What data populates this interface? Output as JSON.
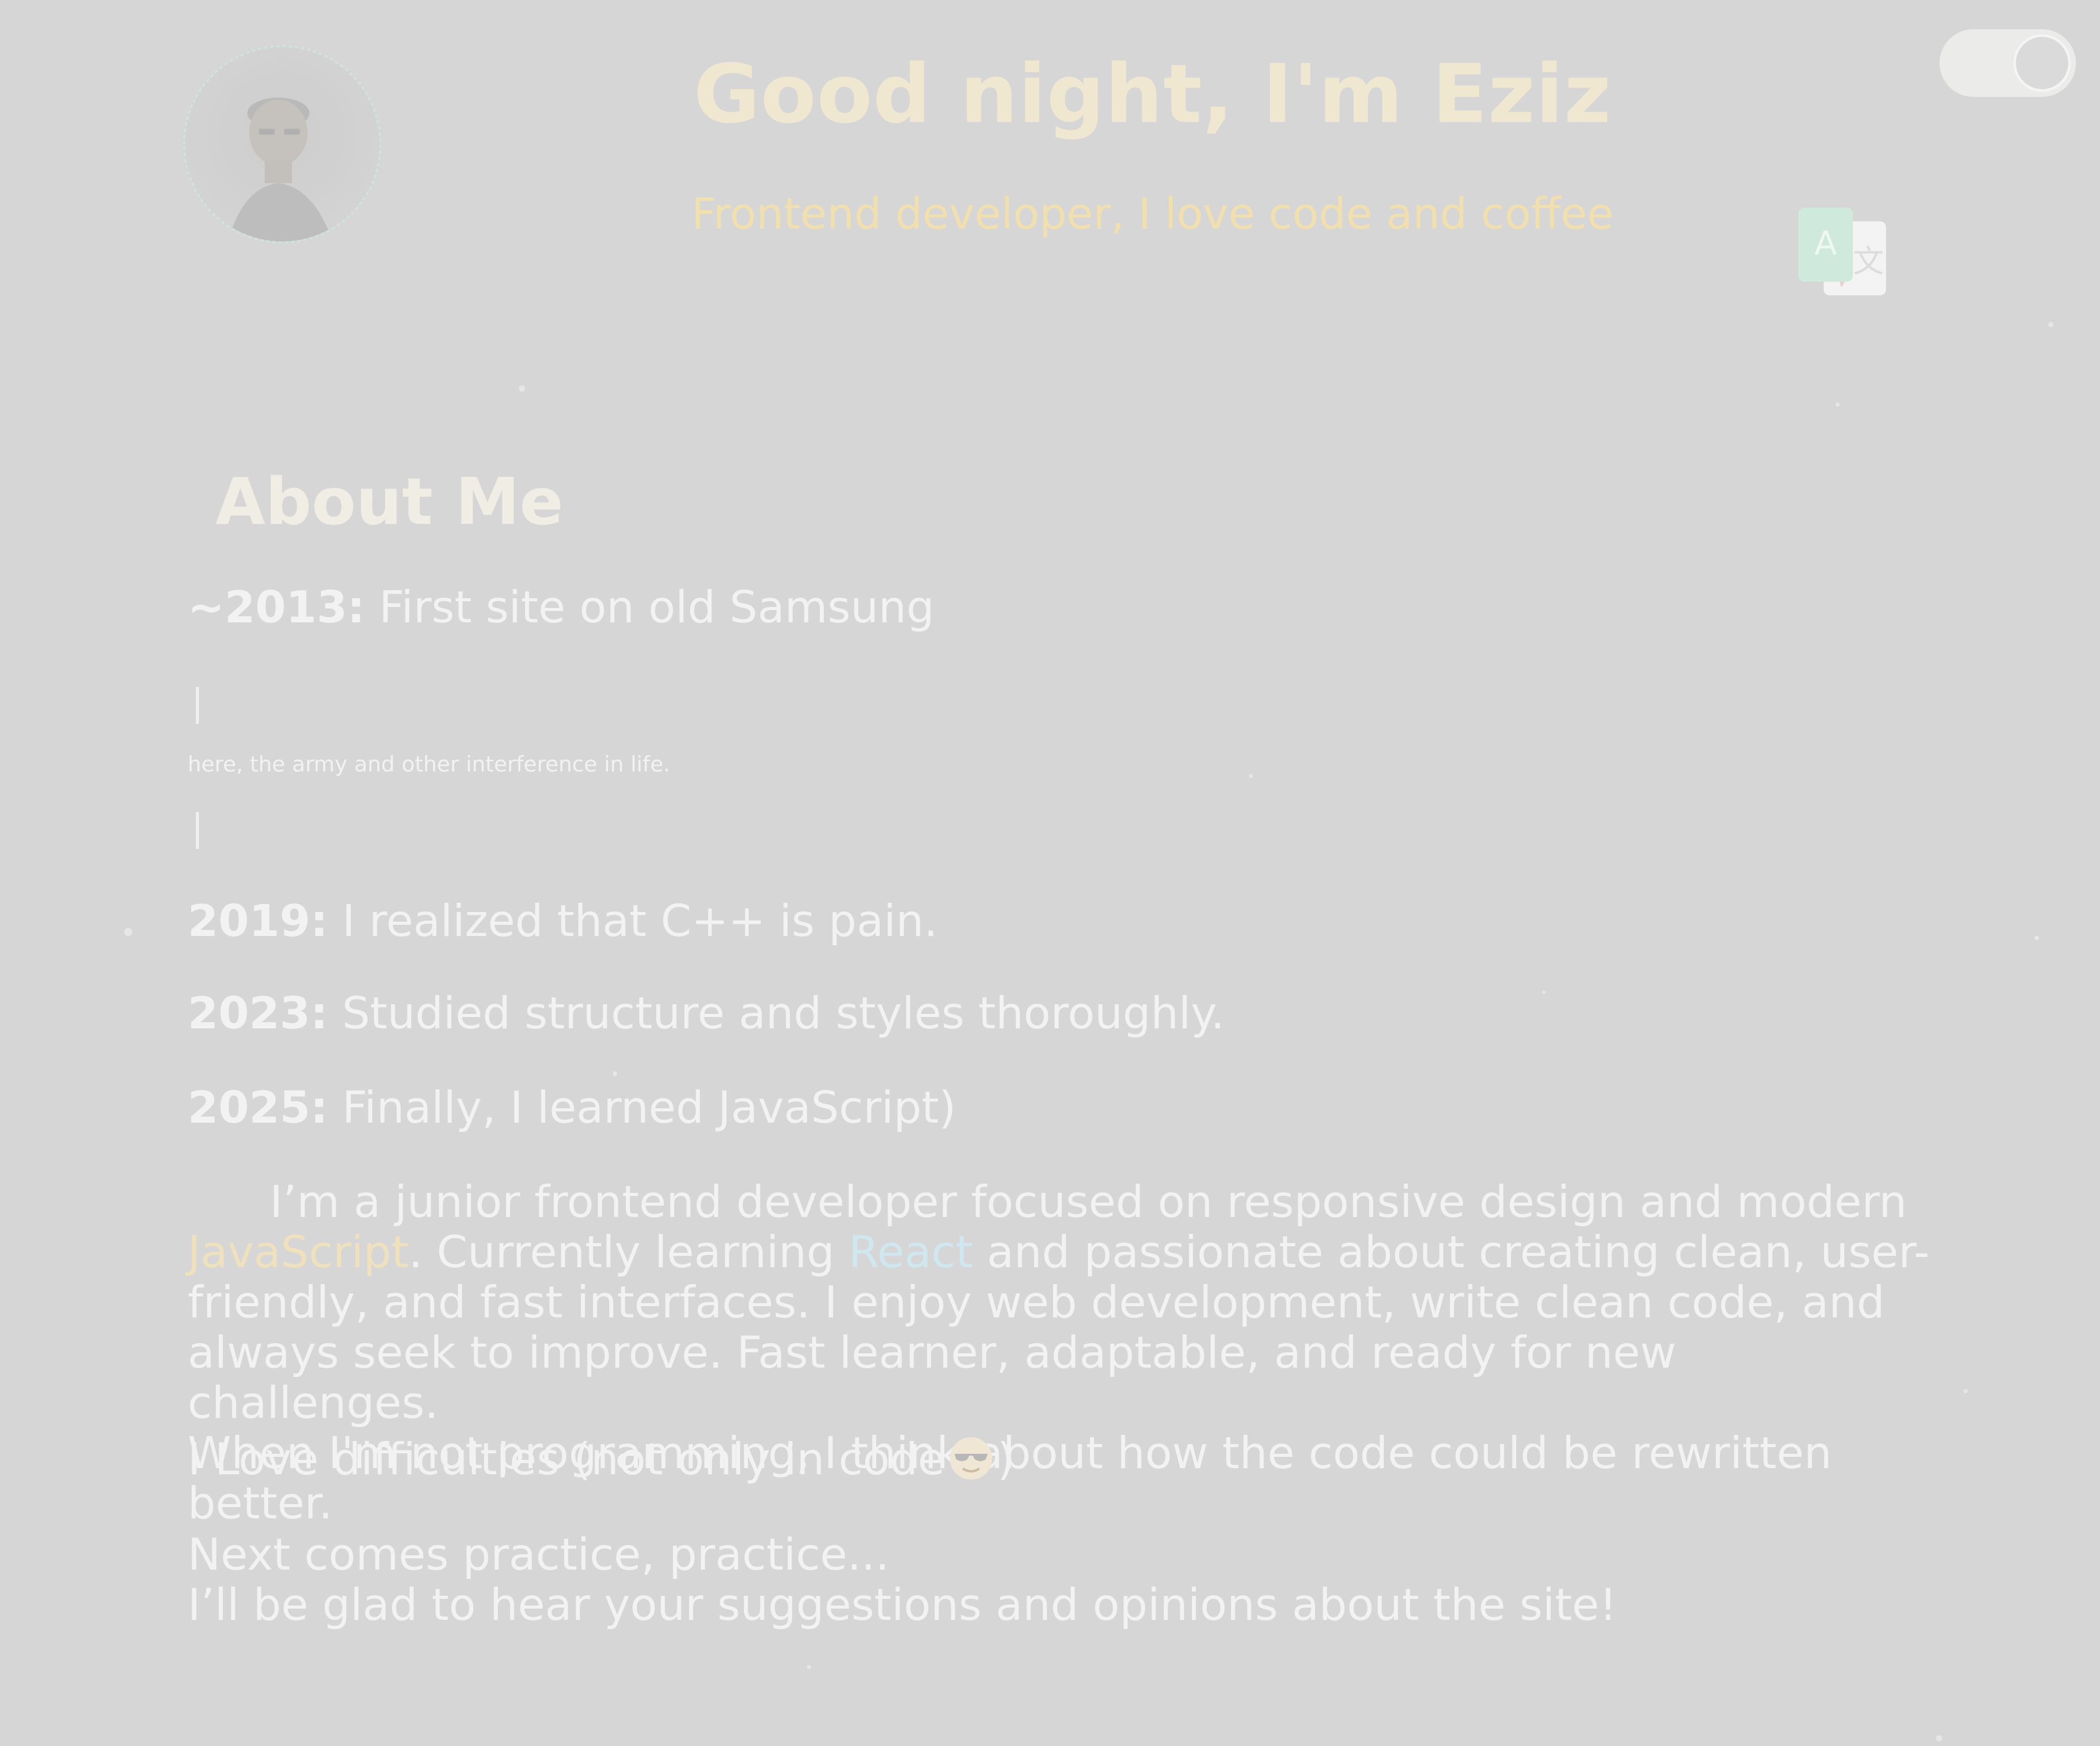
{
  "header": {
    "title": "Good night, I'm Eziz",
    "subtitle": "Frontend developer, I love code and coffee",
    "avatar_icon": "avatar",
    "theme_toggle_icon": "toggle-switch",
    "language_icon": "translate-icon"
  },
  "about": {
    "heading": "About Me",
    "timeline": [
      {
        "year": "~2013:",
        "text": " First site on old Samsung"
      },
      {
        "year": "2019:",
        "text": " I realized that C++ is pain."
      },
      {
        "year": "2023:",
        "text": " Studied structure and styles thoroughly."
      },
      {
        "year": "2025:",
        "text": " Finally, I learned JavaScript)"
      }
    ],
    "bar_symbol": "|",
    "note": "here, the army and other interference in life.",
    "paragraph": {
      "p1": "I’m a junior frontend developer focused on responsive design and modern ",
      "kw1": "JavaScript",
      "p2": ". Currently learning ",
      "kw2": "React",
      "p3": " and passionate about creating clean, user-friendly, and fast interfaces. I enjoy web development, write clean code, and always seek to improve. Fast learner, adaptable, and ready for new challenges.",
      "p4": "When I'm not programming, I think about how the code could be rewritten better."
    },
    "love": {
      "text": "I Love difficulties (not only in code",
      "close": ")",
      "emoji_icon": "sunglasses-emoji"
    },
    "closing": {
      "line1": "Next comes practice, practice...",
      "line2": "I’ll be glad to hear your suggestions and opinions about the site!"
    }
  },
  "colors": {
    "background": "#d6d6d6",
    "title": "#efe7cf",
    "subtitle": "#f1dfae",
    "text": "#f2f2f2",
    "javascript_accent": "#f0e1bd",
    "react_accent": "#cfe8ef"
  }
}
